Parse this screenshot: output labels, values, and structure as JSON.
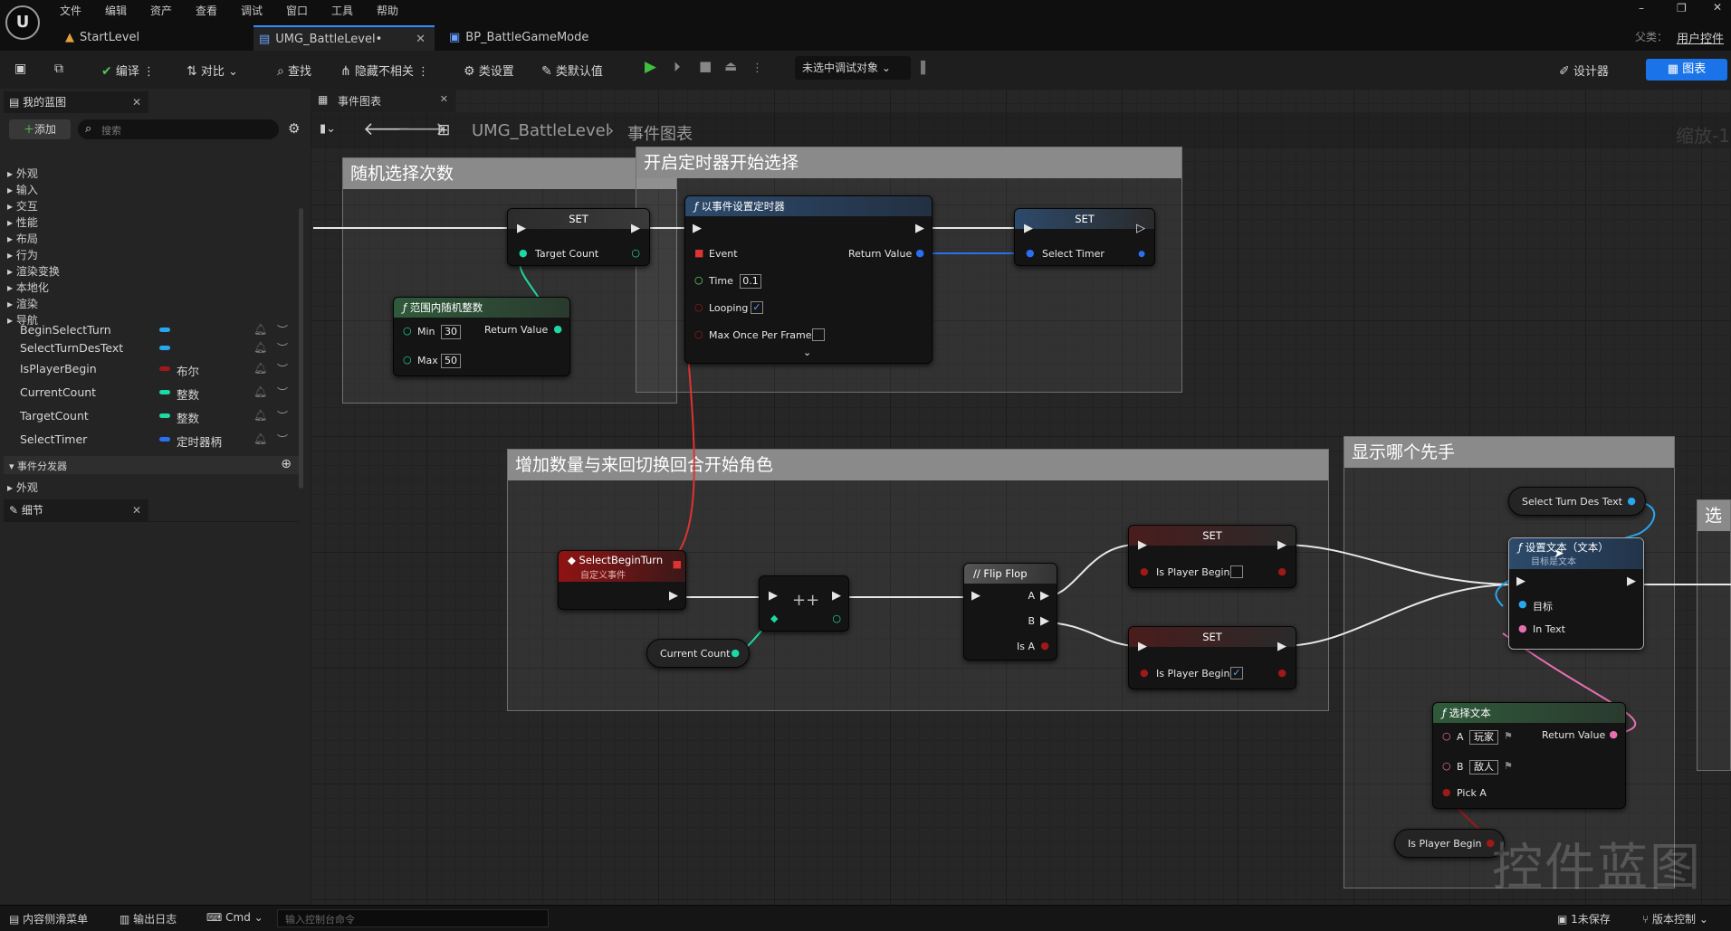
{
  "menu": [
    "文件",
    "编辑",
    "资产",
    "查看",
    "调试",
    "窗口",
    "工具",
    "帮助"
  ],
  "logo_text": "U",
  "tabs": [
    {
      "label": "StartLevel"
    },
    {
      "label": "UMG_BattleLevel•"
    },
    {
      "label": "BP_BattleGameMode"
    }
  ],
  "parent_label": "父类：",
  "parent_value": "用户控件",
  "toolbar": {
    "compile": "编译",
    "diff": "对比",
    "find": "查找",
    "hide_unrelated": "隐藏不相关",
    "class_settings": "类设置",
    "class_defaults": "类默认值",
    "debug_target": "未选中调试对象",
    "designer": "设计器",
    "graph": "图表"
  },
  "mybp": {
    "title": "我的蓝图",
    "add": "添加",
    "search_placeholder": "搜索",
    "categories": [
      "外观",
      "输入",
      "交互",
      "性能",
      "布局",
      "行为",
      "渲染变换",
      "本地化",
      "渲染",
      "导航"
    ],
    "variables": [
      {
        "name": "BeginSelectTurn",
        "type": "",
        "color": "#27a7f0"
      },
      {
        "name": "SelectTurnDesText",
        "type": "",
        "color": "#27a7f0"
      },
      {
        "name": "IsPlayerBegin",
        "type": "布尔",
        "color": "#a01818"
      },
      {
        "name": "CurrentCount",
        "type": "整数",
        "color": "#1ed8a4"
      },
      {
        "name": "TargetCount",
        "type": "整数",
        "color": "#1ed8a4"
      },
      {
        "name": "SelectTimer",
        "type": "定时器柄",
        "color": "#2a6ff0"
      }
    ],
    "dispatchers": "事件分发器",
    "appearance": "外观"
  },
  "details": {
    "title": "细节"
  },
  "graph": {
    "tab": "事件图表",
    "breadcrumb_root": "UMG_BattleLevel",
    "breadcrumb_leaf": "事件图表",
    "zoom": "缩放-1",
    "watermark": "控件蓝图",
    "comments": [
      "随机选择次数",
      "开启定时器开始选择",
      "增加数量与来回切换回合开始角色",
      "显示哪个先手",
      "选"
    ],
    "nodes": {
      "set1": {
        "title": "SET",
        "pin": "Target Count"
      },
      "random": {
        "title": "范围内随机整数",
        "min_label": "Min",
        "min": "30",
        "max_label": "Max",
        "max": "50",
        "ret": "Return Value"
      },
      "timer": {
        "title": "以事件设置定时器",
        "event": "Event",
        "time_label": "Time",
        "time": "0.1",
        "looping": "Looping",
        "max_once": "Max Once Per Frame",
        "ret": "Return Value"
      },
      "set2": {
        "title": "SET",
        "pin": "Select Timer"
      },
      "event": {
        "title": "SelectBeginTurn",
        "sub": "自定义事件"
      },
      "incr": {
        "title": "++"
      },
      "current": {
        "label": "Current Count"
      },
      "flipflop": {
        "title": "Flip Flop",
        "a": "A",
        "b": "B",
        "isa": "Is A"
      },
      "set3": {
        "title": "SET",
        "pin": "Is Player Begin"
      },
      "set4": {
        "title": "SET",
        "pin": "Is Player Begin"
      },
      "selTurnText": {
        "label": "Select Turn Des Text"
      },
      "settext": {
        "title": "设置文本（文本）",
        "sub": "目标是文本",
        "target": "目标",
        "intext": "In Text"
      },
      "select": {
        "title": "选择文本",
        "a": "A",
        "a_val": "玩家",
        "b": "B",
        "b_val": "敌人",
        "pick": "Pick A",
        "ret": "Return Value"
      },
      "isPlayer": {
        "label": "Is Player Begin"
      }
    }
  },
  "statusbar": {
    "content_drawer": "内容侧滑菜单",
    "output_log": "输出日志",
    "cmd": "Cmd",
    "console_placeholder": "输入控制台命令",
    "unsaved": "1未保存",
    "source_control": "版本控制"
  },
  "colors": {
    "accent": "#1a73e8",
    "exec": "#ffffff",
    "int": "#1ed8a4",
    "bool": "#a01818",
    "text": "#e76fb0",
    "timer": "#2a6ff0",
    "obj": "#27a7f0",
    "event_hdr": "#8f1414",
    "func_hdr": "#2c4a6b",
    "pure_hdr": "#2f5a3a"
  }
}
